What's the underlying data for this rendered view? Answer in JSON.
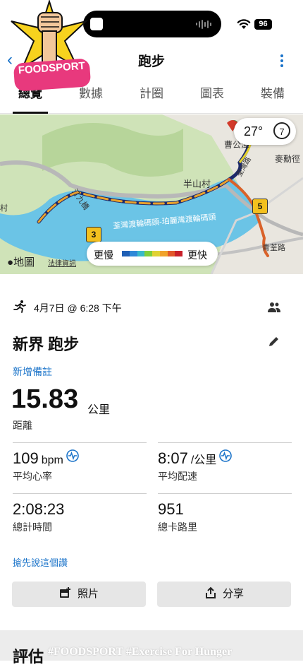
{
  "status_bar": {
    "battery": "96"
  },
  "header": {
    "title": "跑步"
  },
  "tabs": [
    "總覽",
    "數據",
    "計圈",
    "圖表",
    "裝備"
  ],
  "logo": {
    "text": "FOODSPORT"
  },
  "map": {
    "labels": {
      "a": "曹公潭",
      "b": "麥勳徑",
      "c": "半山村",
      "d": "荃灣路",
      "e": "青荃路",
      "f": "汀九橋",
      "g": "村",
      "pier": "荃灣渡輪碼頭-珀麗灣渡輪碼頭"
    },
    "km_markers": [
      "3",
      "5"
    ],
    "weather": {
      "temp": "27°",
      "compass": "7"
    },
    "legend": {
      "slow": "更慢",
      "fast": "更快",
      "colors": [
        "#1f5fb5",
        "#2f89d8",
        "#39b9c9",
        "#7fcf3c",
        "#e0d233",
        "#f0a22a",
        "#e2582a",
        "#c8202a"
      ]
    },
    "attribution": "地圖",
    "legal": "法律資訊"
  },
  "activity": {
    "date": "4月7日 @ 6:28 下午",
    "title": "新界 跑步",
    "add_note": "新增備註",
    "distance_value": "15.83",
    "distance_unit": "公里",
    "distance_label": "距離",
    "stats": {
      "hr": {
        "value": "109",
        "unit": "bpm",
        "label": "平均心率"
      },
      "pace": {
        "value": "8:07",
        "unit": "/公里",
        "label": "平均配速"
      },
      "time": {
        "value": "2:08:23",
        "label": "總計時間"
      },
      "cal": {
        "value": "951",
        "label": "總卡路里"
      }
    },
    "first_like": "搶先說這個讚",
    "photo_button": "照片",
    "share_button": "分享"
  },
  "section": {
    "title": "評估"
  },
  "watermark": "#FOODSPORT #Exercise For Hunger"
}
